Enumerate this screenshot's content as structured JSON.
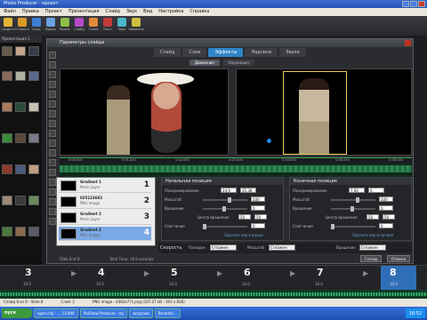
{
  "window": {
    "title": "Photo Producer - проект"
  },
  "menu": [
    "Файл",
    "Правка",
    "Проект",
    "Презентация",
    "Слайд",
    "Звук",
    "Вид",
    "Настройка",
    "Справка"
  ],
  "toolbar": [
    {
      "label": "Создать",
      "icon": "new-icon",
      "color": "#e6b43a"
    },
    {
      "label": "Открыть",
      "icon": "open-icon",
      "color": "#d99a2a"
    },
    {
      "label": "Сохр.",
      "icon": "save-icon",
      "color": "#3d7fd6"
    },
    {
      "label": "Видео",
      "icon": "video-icon",
      "color": "#6aa0e0"
    },
    {
      "label": "Просм.",
      "icon": "preview-icon",
      "color": "#8fbf4a"
    },
    {
      "label": "Слайд",
      "icon": "slide-icon",
      "color": "#b84ac8"
    },
    {
      "label": "Стили",
      "icon": "styles-icon",
      "color": "#e08a3a"
    },
    {
      "label": "Текст",
      "icon": "text-icon",
      "color": "#c23a3a"
    },
    {
      "label": "Звук",
      "icon": "sound-icon",
      "color": "#4ab8c8"
    },
    {
      "label": "Эффекты",
      "icon": "effects-icon",
      "color": "#d0c040"
    }
  ],
  "project": {
    "header": "Презентация 1"
  },
  "dialog": {
    "title": "Параметры слайда",
    "tabs": [
      "Слайд",
      "Слои",
      "Эффекты",
      "Надписи",
      "Звуки"
    ],
    "active_tab": "Эффекты",
    "subtabs": [
      "Движение",
      "Коррекция"
    ],
    "ruler": [
      "0:00.000",
      "0:01.000",
      "0:02.000",
      "0:03.000",
      "0:04.000",
      "0:05.000",
      "0:06.000"
    ],
    "layers": [
      {
        "name": "Gradient 1",
        "sub": "Mask Layer",
        "num": "1"
      },
      {
        "name": "025123603",
        "sub": "PNG image",
        "num": "2"
      },
      {
        "name": "Gradient 2",
        "sub": "Mask Layer",
        "num": "3"
      },
      {
        "name": "Gradient 3",
        "sub": "PNG image",
        "num": "4"
      }
    ],
    "start_panel": {
      "title": "Начальная позиция",
      "labels": [
        "Панорамирование",
        "Масштаб",
        "Вращение",
        "Центр вращения",
        "Смягчение"
      ],
      "values": [
        "24.9",
        "35.38",
        "100",
        "0",
        "50",
        "50",
        "0"
      ],
      "link": "Сделать как в конце"
    },
    "end_panel": {
      "title": "Конечная позиция",
      "labels": [
        "Панорамирование",
        "Масштаб",
        "Вращение",
        "Центр вращения",
        "Смягчение"
      ],
      "values": [
        "7.92",
        "0",
        "100",
        "0",
        "50",
        "50",
        "0"
      ],
      "link": "Сделать как в начале"
    },
    "speed": {
      "label": "Скорость",
      "items": [
        {
          "label": "Панорам",
          "value": "Сглажен"
        },
        {
          "label": "Масштаб",
          "value": "Сглажен"
        },
        {
          "label": "Вращение",
          "value": "Сглажен"
        }
      ]
    },
    "footer": {
      "slide_info": "Slide 8 of 8",
      "total_time": "Total Time: 16.0 seconds",
      "ok": "Готово",
      "cancel": "Отмена"
    }
  },
  "slides": [
    {
      "num": "3",
      "dur": "10.0"
    },
    {
      "num": "4",
      "dur": "10.0"
    },
    {
      "num": "5",
      "dur": "10.0"
    },
    {
      "num": "6",
      "dur": "10.0"
    },
    {
      "num": "7",
      "dur": "10.0"
    },
    {
      "num": "8",
      "dur": "10.0"
    }
  ],
  "status": [
    "Слайд 8 из 8 - Slide 8",
    "Слой: 2",
    "PNG image - 4383e77s.png (107.27 kB - 393 x 836)"
  ],
  "taskbar": {
    "start": "пуск",
    "items": [
      "open city - ... 13.000",
      "ProShow Producer - пр",
      "загрузки",
      "Recordin..."
    ],
    "clock": "18:52"
  }
}
